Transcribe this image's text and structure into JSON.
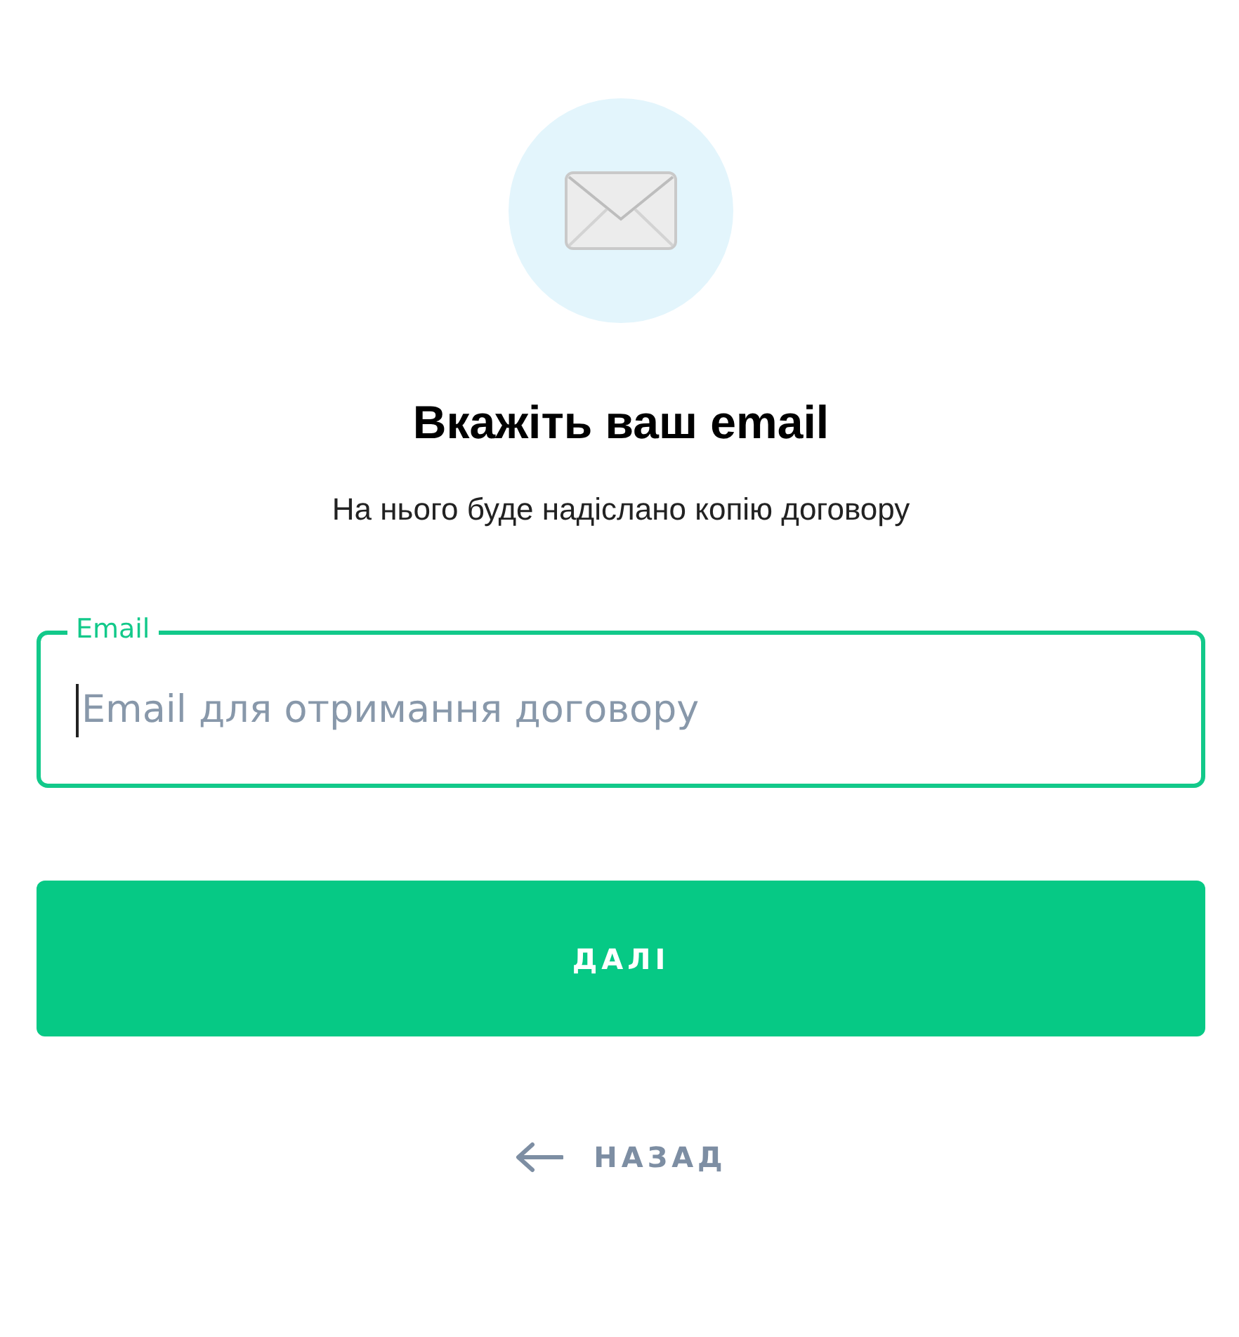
{
  "title": "Вкажіть ваш email",
  "subtitle": "На нього буде надіслано копію договору",
  "email_field": {
    "label": "Email",
    "placeholder": "Email для отримання договору",
    "focused": true
  },
  "next_button": {
    "label": "ДАЛІ"
  },
  "back_link": {
    "label": "НАЗАД"
  }
}
